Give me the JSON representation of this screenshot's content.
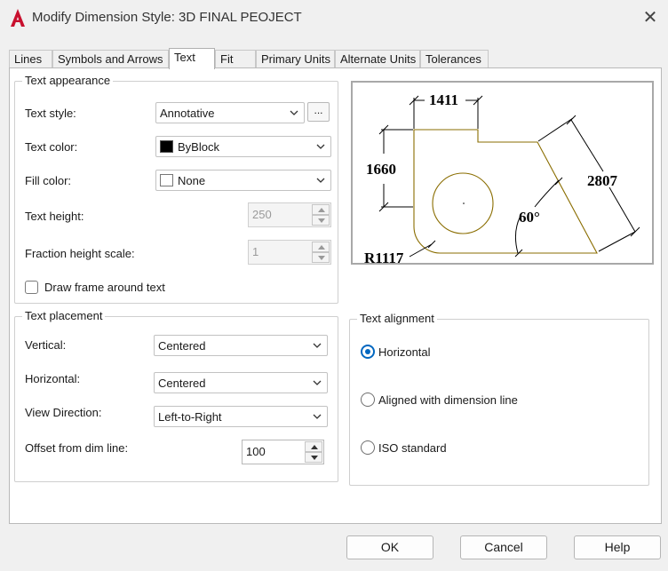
{
  "window": {
    "title": "Modify Dimension Style: 3D FINAL PEOJECT"
  },
  "tabs": [
    {
      "label": "Lines"
    },
    {
      "label": "Symbols and Arrows"
    },
    {
      "label": "Text"
    },
    {
      "label": "Fit"
    },
    {
      "label": "Primary Units"
    },
    {
      "label": "Alternate Units"
    },
    {
      "label": "Tolerances"
    }
  ],
  "active_tab": "Text",
  "text_appearance": {
    "title": "Text appearance",
    "text_style_label": "Text style:",
    "text_style_value": "Annotative",
    "ellipsis_label": "...",
    "text_color_label": "Text color:",
    "text_color_value": "ByBlock",
    "text_color_swatch": "#000000",
    "fill_color_label": "Fill color:",
    "fill_color_value": "None",
    "fill_color_swatch": "#ffffff",
    "text_height_label": "Text height:",
    "text_height_value": "250",
    "fraction_label": "Fraction height scale:",
    "fraction_value": "1",
    "draw_frame_label": "Draw frame around text"
  },
  "text_placement": {
    "title": "Text placement",
    "vertical_label": "Vertical:",
    "vertical_value": "Centered",
    "horizontal_label": "Horizontal:",
    "horizontal_value": "Centered",
    "view_direction_label": "View Direction:",
    "view_direction_value": "Left-to-Right",
    "offset_label": "Offset from dim line:",
    "offset_value": "100"
  },
  "text_alignment": {
    "title": "Text alignment",
    "options": [
      {
        "label": "Horizontal",
        "checked": true
      },
      {
        "label": "Aligned with dimension line",
        "checked": false
      },
      {
        "label": "ISO standard",
        "checked": false
      }
    ]
  },
  "preview": {
    "dim_top": "1411",
    "dim_left": "1660",
    "dim_right": "2807",
    "dim_angle": "60°",
    "dim_radius": "R1117",
    "geometry_color": "#8a6d00"
  },
  "buttons": {
    "ok": "OK",
    "cancel": "Cancel",
    "help": "Help"
  },
  "colors": {
    "accent": "#0067c0",
    "app_icon": "#c8102e"
  }
}
